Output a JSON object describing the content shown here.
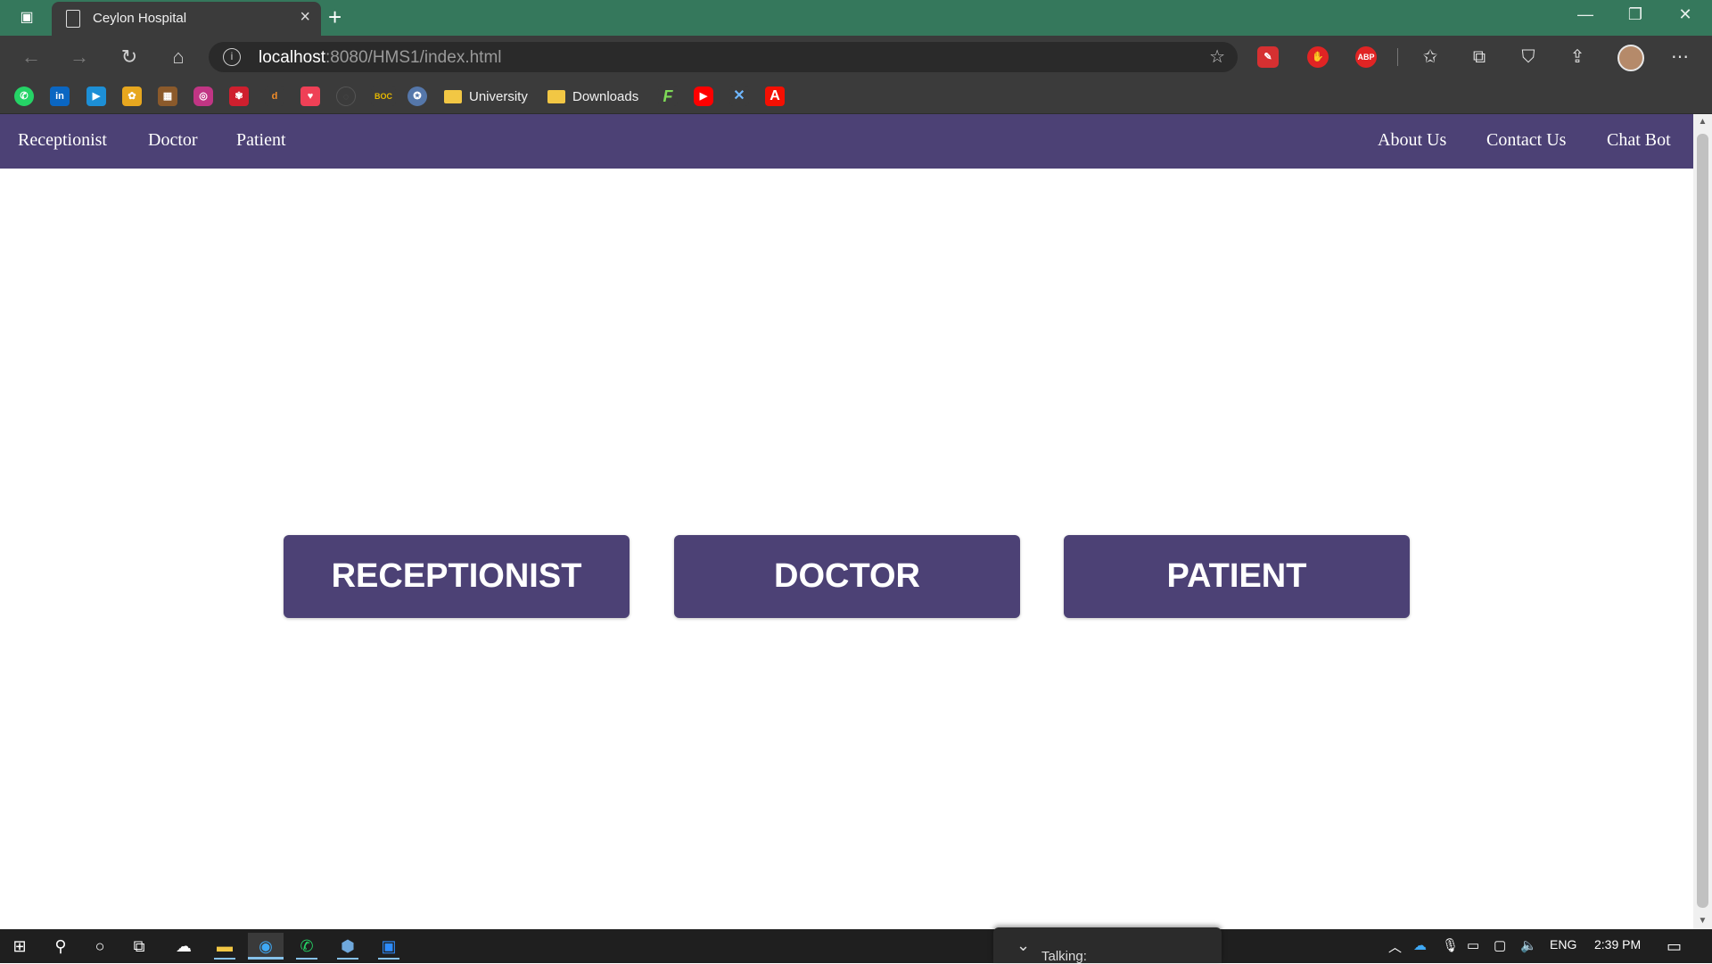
{
  "browser": {
    "tab_title": "Ceylon Hospital",
    "url_host": "localhost",
    "url_rest": ":8080/HMS1/index.html",
    "new_tab_label": "+",
    "close_label": "×"
  },
  "bookmarks": {
    "folders": [
      "University",
      "Downloads"
    ]
  },
  "site": {
    "nav_left": [
      "Receptionist",
      "Doctor",
      "Patient"
    ],
    "nav_right": [
      "About Us",
      "Contact Us",
      "Chat Bot"
    ],
    "role_buttons": [
      "RECEPTIONIST",
      "DOCTOR",
      "PATIENT"
    ],
    "brand_color": "#4c4175"
  },
  "taskbar": {
    "popup_text": "Talking:",
    "language": "ENG",
    "time": "2:39 PM"
  },
  "extensions": {
    "abp_label": "ABP",
    "boc_label": "BOC"
  }
}
